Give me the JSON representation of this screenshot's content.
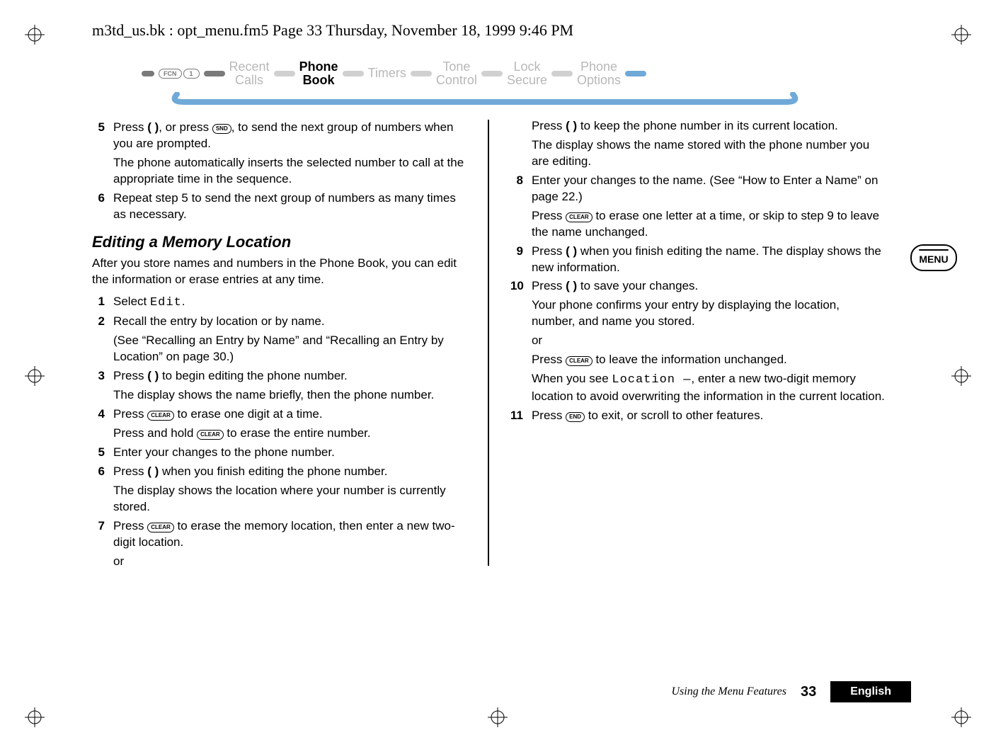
{
  "header": "m3td_us.bk : opt_menu.fm5  Page 33  Thursday, November 18, 1999  9:46 PM",
  "nav": {
    "fcn": "FCN",
    "one": "1",
    "items": [
      {
        "l1": "Recent",
        "l2": "Calls"
      },
      {
        "l1": "Phone",
        "l2": "Book"
      },
      {
        "l1": "Timers",
        "l2": ""
      },
      {
        "l1": "Tone",
        "l2": "Control"
      },
      {
        "l1": "Lock",
        "l2": "Secure"
      },
      {
        "l1": "Phone",
        "l2": "Options"
      }
    ]
  },
  "menu_badge": "MENU",
  "icons": {
    "snd": "SND",
    "clear": "CLEAR",
    "end": "END"
  },
  "left": {
    "s5a": "Press ",
    "s5b": ", or press ",
    "s5c": ", to send the next group of numbers when you are prompted.",
    "s5sub": "The phone automatically inserts the selected number to call at the appropriate time in the sequence.",
    "s6": "Repeat step 5 to send the next group of numbers as many times as necessary.",
    "h": "Editing a Memory Location",
    "intro": "After you store names and numbers in the Phone Book, you can edit the information or erase entries at any time.",
    "s1a": "Select ",
    "s1code": "Edit",
    "s1b": ".",
    "s2": "Recall the entry by location or by name.",
    "s2sub": "(See “Recalling an Entry by Name”  and “Recalling an Entry by Location” on page 30.)",
    "s3a": "Press ",
    "s3b": " to begin editing the phone number.",
    "s3sub": "The display shows the name briefly, then the phone number.",
    "s4a": "Press ",
    "s4b": " to erase one digit at a time.",
    "s4sub_a": "Press and hold ",
    "s4sub_b": " to erase the entire number.",
    "s5_2": "Enter your changes to the phone number.",
    "s6_2a": "Press ",
    "s6_2b": " when you finish editing the phone number.",
    "s6_2sub": "The display shows the location where your number is currently stored.",
    "s7a": "Press ",
    "s7b": " to erase the memory location, then enter a new two-digit location.",
    "or": "or"
  },
  "right": {
    "r7a": "Press ",
    "r7b": " to keep the phone number in its current location.",
    "r7sub": "The display shows the name stored with the phone number you are editing.",
    "s8": "Enter your changes to the name. (See “How to Enter a Name” on page 22.)",
    "s8sub_a": "Press ",
    "s8sub_b": " to erase one letter at a time, or skip to step 9 to leave the name unchanged.",
    "s9a": "Press ",
    "s9b": " when you finish editing the name. The display shows the new information.",
    "s10a": "Press ",
    "s10b": " to save your changes.",
    "s10sub": "Your phone confirms your entry by displaying the location, number, and name you stored.",
    "or": "or",
    "s10or_a": "Press ",
    "s10or_b": " to leave the information unchanged.",
    "s10loc_a": "When you see ",
    "s10loc_code": "Location  —",
    "s10loc_b": ", enter a new two-digit memory location to avoid overwriting the information in the current location.",
    "s11a": "Press ",
    "s11b": " to exit, or scroll to other features."
  },
  "footer": {
    "title": "Using the Menu Features",
    "page": "33",
    "lang": "English"
  }
}
